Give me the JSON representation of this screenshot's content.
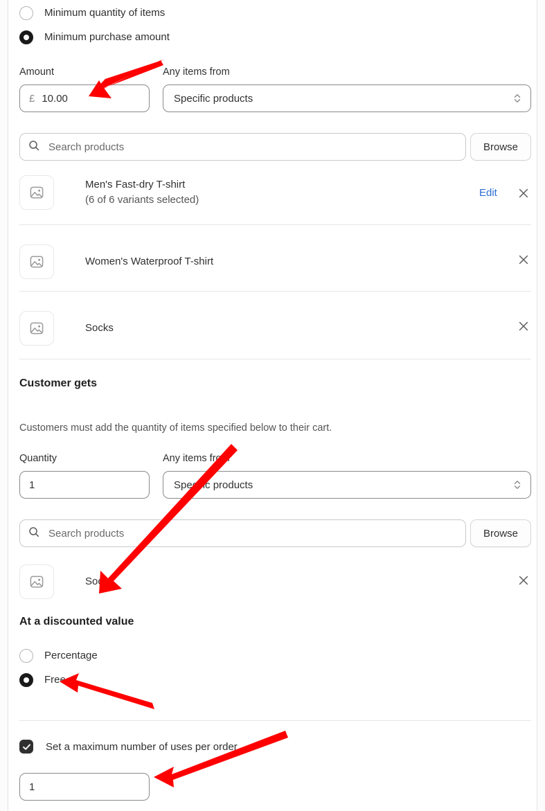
{
  "currency_symbol": "£",
  "accent_link_color": "#2b6cd4",
  "annotation_color": "#ff0000",
  "minimum_requirement": {
    "options": [
      {
        "label": "Minimum quantity of items",
        "selected": false
      },
      {
        "label": "Minimum purchase amount",
        "selected": true
      }
    ]
  },
  "buys_section": {
    "amount_label": "Amount",
    "amount_prefix": "£",
    "amount_value": "10.00",
    "items_from_label": "Any items from",
    "items_from_value": "Specific products",
    "search_placeholder": "Search products",
    "browse_label": "Browse",
    "products": [
      {
        "title": "Men's Fast-dry T-shirt",
        "subtitle": "(6 of 6 variants selected)",
        "edit_label": "Edit",
        "has_edit": true,
        "remove_label": "×"
      },
      {
        "title": "Women's Waterproof T-shirt",
        "subtitle": "",
        "edit_label": "",
        "has_edit": false,
        "remove_label": "×"
      },
      {
        "title": "Socks",
        "subtitle": "",
        "edit_label": "",
        "has_edit": false,
        "remove_label": "×"
      }
    ]
  },
  "gets_section": {
    "title": "Customer gets",
    "helper_text": "Customers must add the quantity of items specified below to their cart.",
    "quantity_label": "Quantity",
    "quantity_value": "1",
    "items_from_label": "Any items from",
    "items_from_value": "Specific products",
    "search_placeholder": "Search products",
    "browse_label": "Browse",
    "products": [
      {
        "title": "Socks",
        "subtitle": "",
        "remove_label": "×"
      }
    ]
  },
  "discounted_value": {
    "title": "At a discounted value",
    "options": [
      {
        "label": "Percentage",
        "selected": false
      },
      {
        "label": "Free",
        "selected": true
      }
    ]
  },
  "max_uses": {
    "checkbox_label": "Set a maximum number of uses per order",
    "checked": true,
    "value": "1"
  },
  "icons": {
    "search": "search-icon",
    "select_arrows": "chevron-up-down-icon",
    "thumbnail": "image-placeholder-icon",
    "remove": "close-icon",
    "checkmark": "check-icon"
  }
}
